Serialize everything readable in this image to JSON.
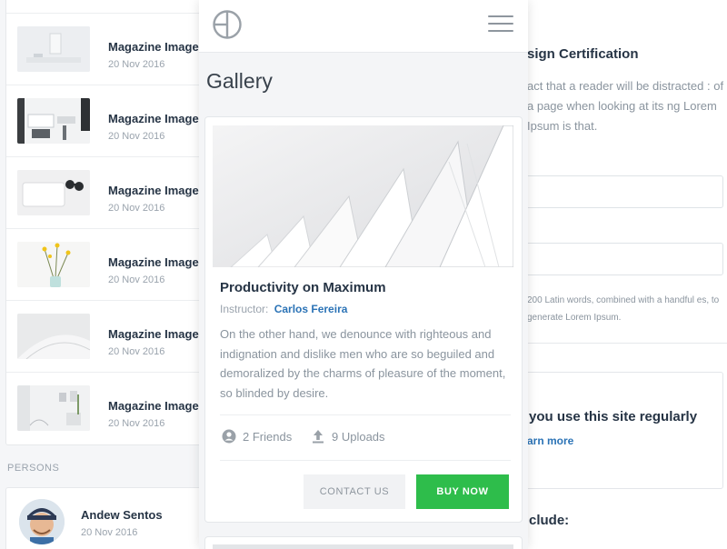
{
  "left_list": {
    "items": [
      {
        "title": "Magazine Image",
        "date": "20 Nov 2016",
        "thumb_icon": "desk-photo-icon"
      },
      {
        "title": "Magazine Image",
        "date": "20 Nov 2016",
        "thumb_icon": "office-photo-icon"
      },
      {
        "title": "Magazine Image",
        "date": "20 Nov 2016",
        "thumb_icon": "keyboard-photo-icon"
      },
      {
        "title": "Magazine Image",
        "date": "20 Nov 2016",
        "thumb_icon": "flowers-photo-icon"
      },
      {
        "title": "Magazine Image",
        "date": "20 Nov 2016",
        "thumb_icon": "architecture-photo-icon"
      },
      {
        "title": "Magazine Image",
        "date": "20 Nov 2016",
        "thumb_icon": "room-photo-icon"
      }
    ],
    "section_label": "PERSONS",
    "person": {
      "name": "Andew Sentos",
      "date": "20 Nov 2016"
    }
  },
  "phone": {
    "page_title": "Gallery",
    "card": {
      "title": "Productivity on Maximum",
      "instructor_label": "Instructor:",
      "instructor_name": "Carlos Fereira",
      "description": "On the other hand, we denounce with righteous and indignation and dislike men who are so beguiled and demoralized by the charms of pleasure of the moment, so blinded by desire.",
      "friends": "2 Friends",
      "uploads": "9 Uploads",
      "contact_label": "CONTACT US",
      "buy_label": "BUY NOW"
    }
  },
  "right_panel": {
    "cert_title": "sign Certification",
    "cert_text": "act that a reader will be distracted : of a page when looking at its ng Lorem Ipsum is that.",
    "latin_note": "200 Latin words, combined with a handful es, to generate Lorem Ipsum.",
    "regular_title": "you use this site regularly",
    "learn_more": "arn more",
    "include_title": "clude:"
  },
  "colors": {
    "accent_blue": "#2b73b6",
    "buy_green": "#2ebd4b",
    "heading": "#263445",
    "muted_text": "#8a949e"
  }
}
